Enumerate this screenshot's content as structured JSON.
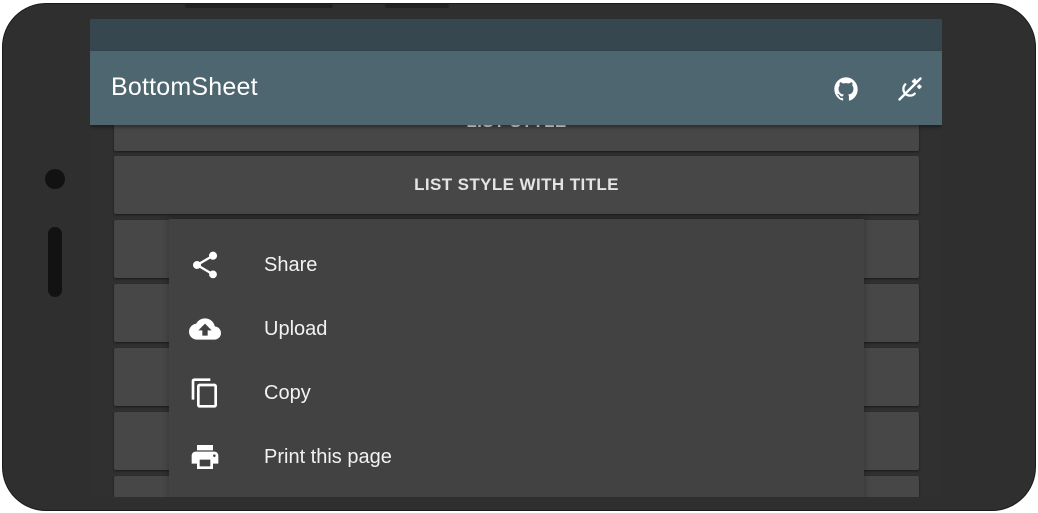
{
  "app": {
    "title": "BottomSheet"
  },
  "appbar": {
    "actions": [
      {
        "icon": "github-icon"
      },
      {
        "icon": "theme-toggle-icon"
      }
    ]
  },
  "buttons": [
    {
      "label": "LIST STYLE"
    },
    {
      "label": "LIST STYLE WITH TITLE"
    }
  ],
  "bottom_sheet": {
    "items": [
      {
        "label": "Share",
        "icon": "share-icon"
      },
      {
        "label": "Upload",
        "icon": "cloud-upload-icon"
      },
      {
        "label": "Copy",
        "icon": "copy-icon"
      },
      {
        "label": "Print this page",
        "icon": "print-icon"
      }
    ]
  },
  "colors": {
    "statusbar": "#37474f",
    "appbar": "#4e6670",
    "background": "#303030",
    "button": "#474747",
    "sheet": "#424242",
    "text": "#ffffff"
  }
}
